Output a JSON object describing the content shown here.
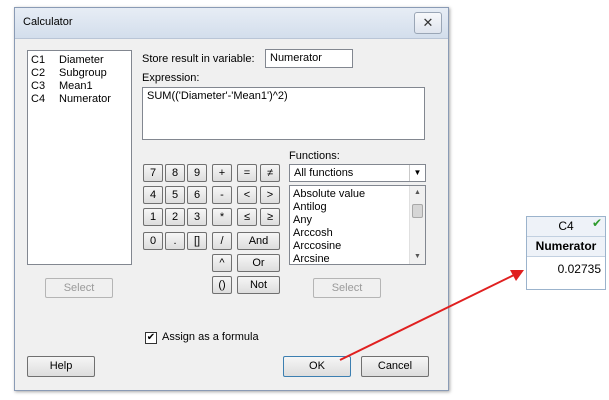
{
  "dialog": {
    "title": "Calculator",
    "close_glyph": "✕",
    "columns": [
      {
        "id": "C1",
        "name": "Diameter"
      },
      {
        "id": "C2",
        "name": "Subgroup"
      },
      {
        "id": "C3",
        "name": "Mean1"
      },
      {
        "id": "C4",
        "name": "Numerator"
      }
    ],
    "store_label": "Store result in variable:",
    "store_value": "Numerator",
    "expression_label": "Expression:",
    "expression_value": "SUM(('Diameter'-'Mean1')^2)",
    "keypad": {
      "k7": "7",
      "k8": "8",
      "k9": "9",
      "plus": "+",
      "eq": "=",
      "neq": "≠",
      "k4": "4",
      "k5": "5",
      "k6": "6",
      "minus": "-",
      "lt": "<",
      "gt": ">",
      "k1": "1",
      "k2": "2",
      "k3": "3",
      "mul": "*",
      "le": "≤",
      "ge": "≥",
      "k0": "0",
      "dot": ".",
      "brackets": "[]",
      "div": "/",
      "and": "And",
      "pow": "^",
      "or": "Or",
      "parens": "()",
      "not": "Not"
    },
    "functions_label": "Functions:",
    "functions_filter": "All functions",
    "functions": [
      "Absolute value",
      "Antilog",
      "Any",
      "Arccosh",
      "Arccosine",
      "Arcsine"
    ],
    "select_left_label": "Select",
    "select_right_label": "Select",
    "assign_formula_label": "Assign as a formula",
    "assign_formula_checked": true,
    "check_glyph": "✔",
    "help_label": "Help",
    "ok_label": "OK",
    "cancel_label": "Cancel"
  },
  "worksheet": {
    "column_id": "C4",
    "column_name": "Numerator",
    "value": "0.02735",
    "formula_check_glyph": "✔"
  },
  "colors": {
    "arrow": "#e02020",
    "formula_check": "#2d9b2d"
  }
}
